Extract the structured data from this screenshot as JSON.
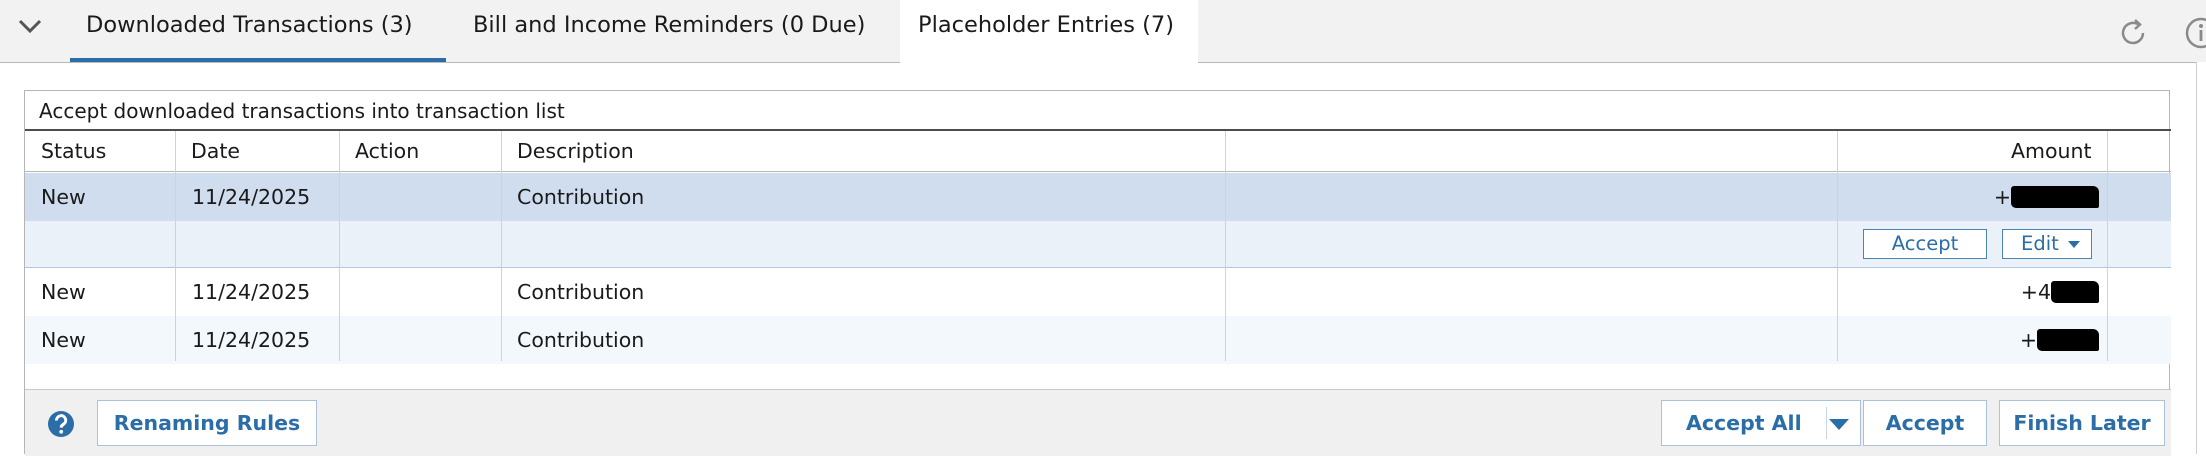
{
  "tabs": [
    {
      "label": "Downloaded Transactions (3)",
      "active": true
    },
    {
      "label": "Bill and Income Reminders (0 Due)",
      "active": false
    },
    {
      "label": "Placeholder Entries (7)",
      "active": false
    }
  ],
  "toolbar_icons": [
    "chevron-down-icon",
    "refresh-icon",
    "info-icon"
  ],
  "panel": {
    "caption": "Accept downloaded transactions into transaction list",
    "columns": [
      "Status",
      "Date",
      "Action",
      "Description",
      "",
      "Amount"
    ],
    "rows": [
      {
        "status": "New",
        "date": "11/24/2025",
        "action": "",
        "description": "Contribution",
        "amount_sign": "+",
        "amount_redacted": true,
        "selected": true
      },
      {
        "status": "New",
        "date": "11/24/2025",
        "action": "",
        "description": "Contribution",
        "amount_sign": "+4",
        "amount_redacted": true,
        "selected": false
      },
      {
        "status": "New",
        "date": "11/24/2025",
        "action": "",
        "description": "Contribution",
        "amount_sign": "+",
        "amount_redacted": true,
        "selected": false
      }
    ],
    "row_actions": {
      "accept": "Accept",
      "edit": "Edit"
    }
  },
  "footer": {
    "renaming_rules": "Renaming Rules",
    "accept_all": "Accept All",
    "accept": "Accept",
    "finish_later": "Finish Later"
  },
  "colors": {
    "accent": "#2b6ea7",
    "selected_row": "#cfddef",
    "selected_row_expanded": "#ebf1f9",
    "alt_row": "#f3f8fc",
    "tab_bar": "#f2f2f2",
    "footer": "#f0f0f0"
  }
}
